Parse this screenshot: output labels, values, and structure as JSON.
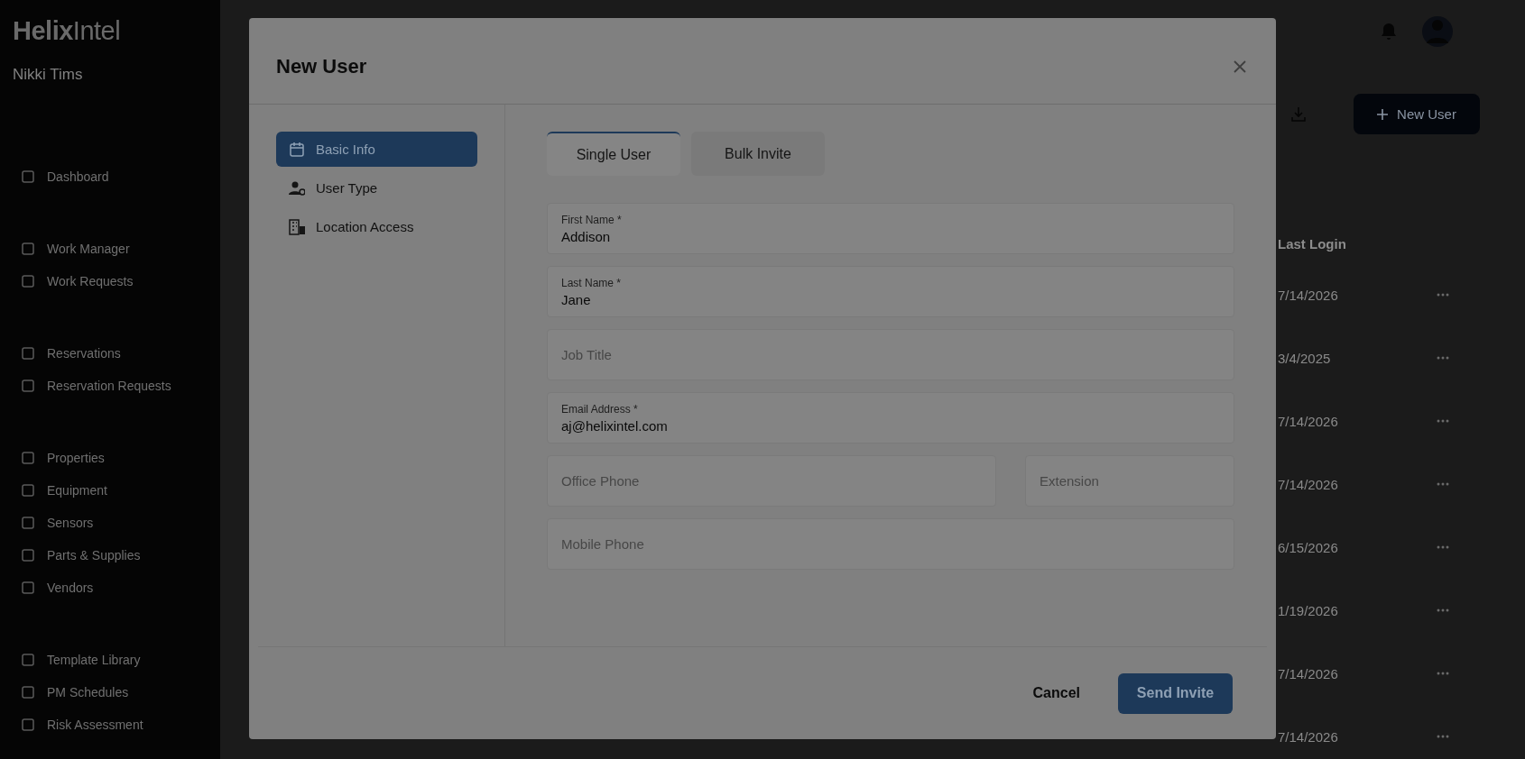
{
  "sidebar": {
    "logo": "**Helix**Intel",
    "user_name": "Nikki Tims",
    "groups": [
      {
        "items": [
          "Dashboard"
        ]
      },
      {
        "items": [
          "Work Manager",
          "Work Requests"
        ]
      },
      {
        "items": [
          "Reservations",
          "Reservation Requests"
        ]
      },
      {
        "items": [
          "Properties",
          "Equipment",
          "Sensors",
          "Parts & Supplies",
          "Vendors"
        ]
      },
      {
        "items": [
          "Template Library",
          "PM Schedules",
          "Risk Assessment"
        ]
      }
    ]
  },
  "main": {
    "new_user_button": "New User",
    "table": {
      "column": "Last Login",
      "rows": [
        "7/14/2026",
        "3/4/2025",
        "7/14/2026",
        "7/14/2026",
        "6/15/2026",
        "1/19/2026",
        "7/14/2026",
        "7/14/2026"
      ]
    }
  },
  "modal": {
    "title": "New User",
    "nav": [
      {
        "label": "Basic Info",
        "selected": true
      },
      {
        "label": "User Type",
        "selected": false
      },
      {
        "label": "Location Access",
        "selected": false
      }
    ],
    "tabs": [
      {
        "label": "Single User",
        "selected": true
      },
      {
        "label": "Bulk Invite",
        "selected": false
      }
    ],
    "field_rows": [
      [
        {
          "label": "First Name *",
          "value": "Addison"
        }
      ],
      [
        {
          "label": "Last Name *",
          "value": "Jane"
        }
      ],
      [
        {
          "placeholder": "Job Title"
        }
      ],
      [
        {
          "label": "Email Address *",
          "value": "aj@helixintel.com"
        }
      ],
      [
        {
          "placeholder": "Office Phone"
        },
        {
          "placeholder": "Extension"
        }
      ],
      [
        {
          "placeholder": "Mobile Phone"
        }
      ]
    ],
    "cancel": "Cancel",
    "submit": "Send Invite"
  }
}
